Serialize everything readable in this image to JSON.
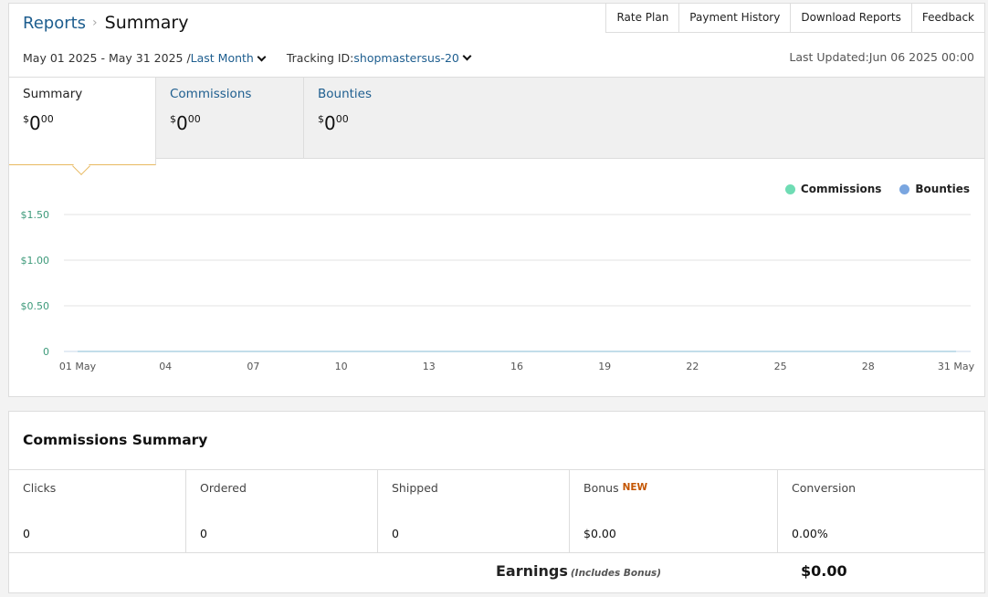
{
  "breadcrumb": {
    "root": "Reports",
    "separator": "›",
    "current": "Summary"
  },
  "topnav": [
    "Rate Plan",
    "Payment History",
    "Download Reports",
    "Feedback"
  ],
  "filters": {
    "date_range": "May 01 2025 - May 31 2025 /",
    "period": "Last Month",
    "tracking_label": "Tracking ID:",
    "tracking_id": "shopmastersus-20",
    "last_updated": "Last Updated:Jun 06 2025 00:00"
  },
  "tabs": [
    {
      "label": "Summary",
      "currency": "$",
      "whole": "0",
      "cents": "00"
    },
    {
      "label": "Commissions",
      "currency": "$",
      "whole": "0",
      "cents": "00"
    },
    {
      "label": "Bounties",
      "currency": "$",
      "whole": "0",
      "cents": "00"
    }
  ],
  "chart_data": {
    "type": "line",
    "x": [
      "01 May",
      "04",
      "07",
      "10",
      "13",
      "16",
      "19",
      "22",
      "25",
      "28",
      "31 May"
    ],
    "series": [
      {
        "name": "Commissions",
        "color": "#6fdcb4",
        "values": [
          0,
          0,
          0,
          0,
          0,
          0,
          0,
          0,
          0,
          0,
          0
        ]
      },
      {
        "name": "Bounties",
        "color": "#7aa6e0",
        "values": [
          0,
          0,
          0,
          0,
          0,
          0,
          0,
          0,
          0,
          0,
          0
        ]
      }
    ],
    "y_ticks": [
      {
        "value": 1.5,
        "label": "$1.50"
      },
      {
        "value": 1.0,
        "label": "$1.00"
      },
      {
        "value": 0.5,
        "label": "$0.50"
      },
      {
        "value": 0,
        "label": "0"
      }
    ],
    "ylim": [
      0,
      1.5
    ],
    "grid": true,
    "legend": "top-right",
    "tick_label_color": "#3d9a7a"
  },
  "commissions_summary": {
    "title": "Commissions Summary",
    "stats": [
      {
        "label": "Clicks",
        "value": "0"
      },
      {
        "label": "Ordered",
        "value": "0"
      },
      {
        "label": "Shipped",
        "value": "0"
      },
      {
        "label": "Bonus",
        "badge": "NEW",
        "value": "$0.00"
      },
      {
        "label": "Conversion",
        "value": "0.00%"
      }
    ],
    "earnings_label": "Earnings",
    "earnings_note": "(Includes Bonus)",
    "earnings_value": "$0.00"
  }
}
